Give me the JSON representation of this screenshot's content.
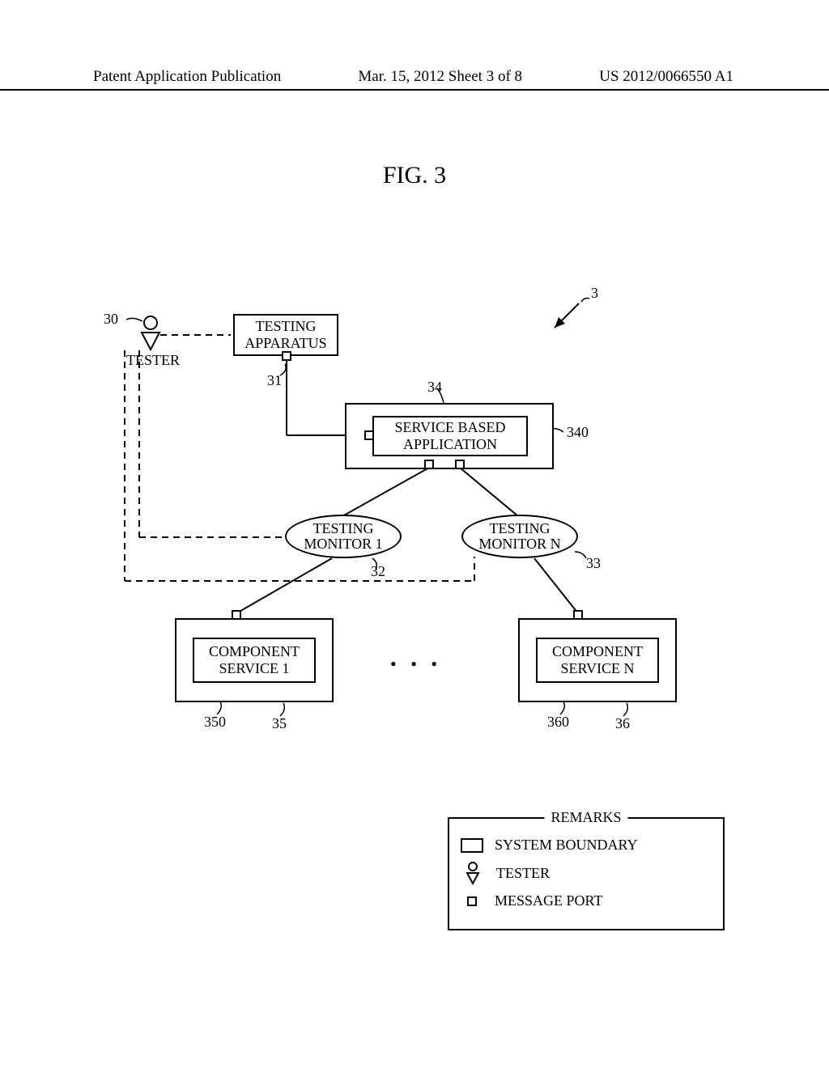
{
  "header": {
    "left": "Patent Application Publication",
    "center": "Mar. 15, 2012  Sheet 3 of 8",
    "right": "US 2012/0066550 A1"
  },
  "figure": {
    "title": "FIG. 3"
  },
  "refs": {
    "sys": "3",
    "tester_sym": "30",
    "tester_label": "TESTER",
    "testing_apparatus": "TESTING\nAPPARATUS",
    "testing_apparatus_num": "31",
    "node34": "34",
    "sba": "SERVICE BASED\nAPPLICATION",
    "sba_num": "340",
    "tm1": "TESTING\nMONITOR 1",
    "tm1_num": "32",
    "tmn": "TESTING\nMONITOR N",
    "tmn_num": "33",
    "cs1": "COMPONENT\nSERVICE 1",
    "cs1_inner": "350",
    "cs1_outer": "35",
    "csn": "COMPONENT\nSERVICE N",
    "csn_inner": "360",
    "csn_outer": "36",
    "dots": "• • •"
  },
  "remarks": {
    "title": "REMARKS",
    "row1": "SYSTEM BOUNDARY",
    "row2": "TESTER",
    "row3": "MESSAGE PORT"
  }
}
